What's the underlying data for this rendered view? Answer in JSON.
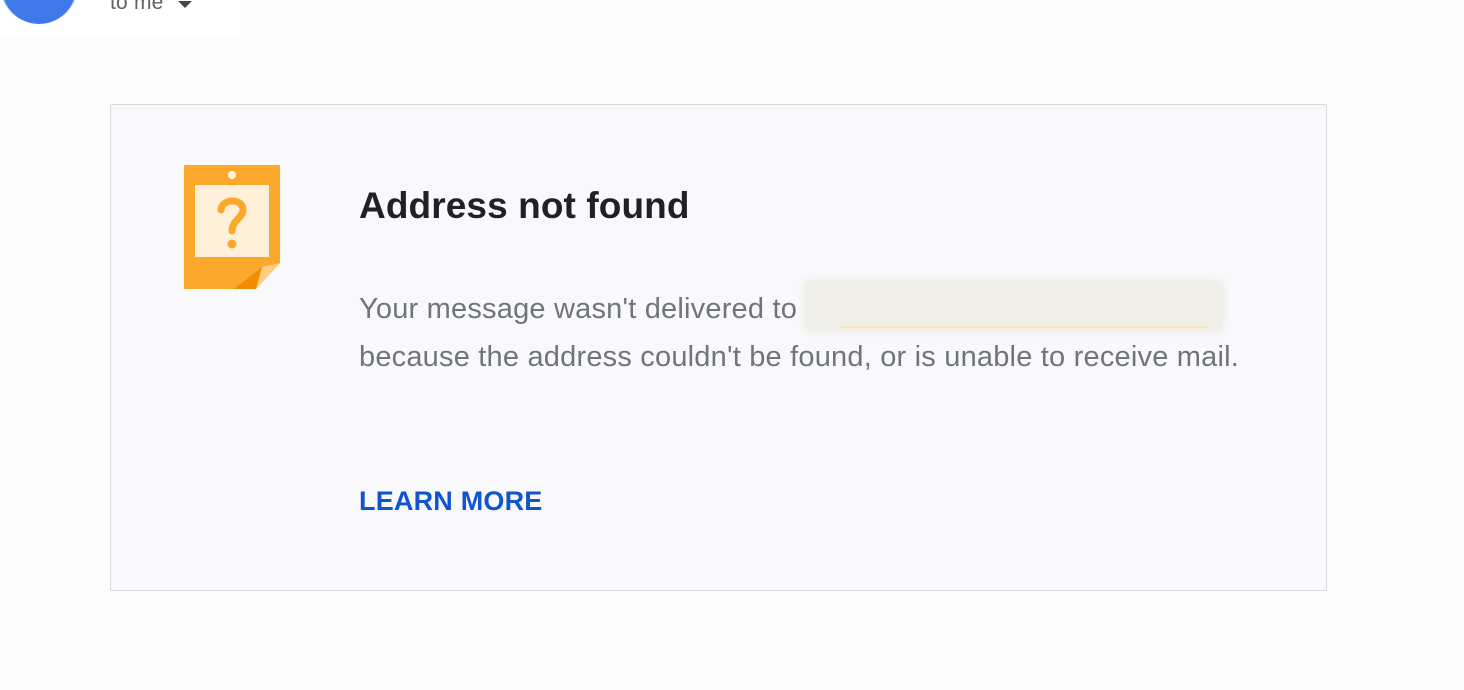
{
  "header": {
    "recipient_label": "to me"
  },
  "bounce_card": {
    "title": "Address not found",
    "message_prefix": "Your message wasn't delivered to",
    "message_suffix": "because the address couldn't be found, or is unable to receive mail.",
    "learn_more_label": "LEARN MORE",
    "icon": "question-note-icon",
    "colors": {
      "icon_primary": "#fba92c",
      "icon_dark": "#f48c00",
      "icon_paper": "#fff0d9",
      "link": "#1155cc",
      "title": "#202124",
      "body_text": "#70757a"
    }
  }
}
